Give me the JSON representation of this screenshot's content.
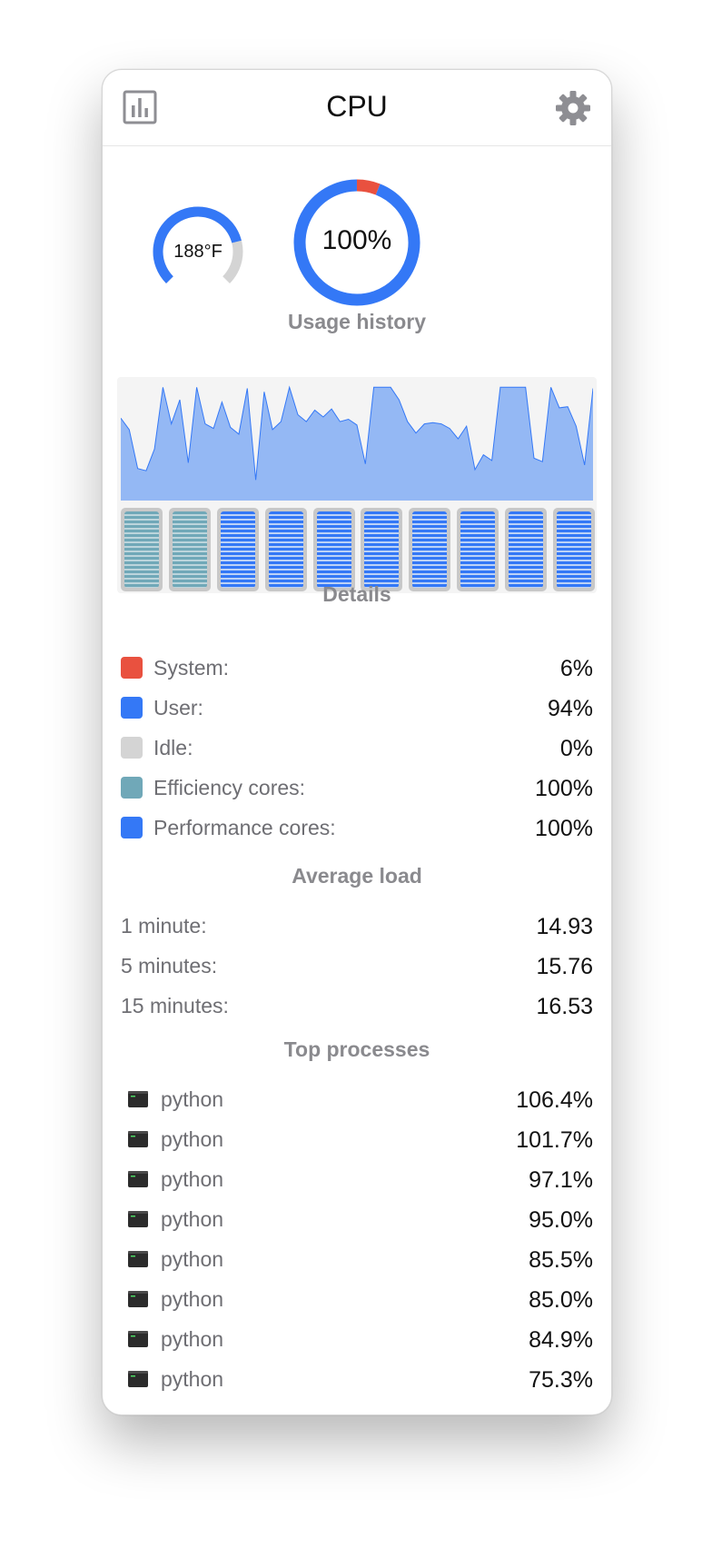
{
  "header": {
    "title": "CPU",
    "left_icon": "chart-icon",
    "right_icon": "gear-icon"
  },
  "gauges": {
    "temperature": {
      "text": "188°F",
      "fill_fraction": 0.78
    },
    "usage": {
      "text": "100%",
      "system_fraction": 0.06,
      "user_fraction": 0.94
    }
  },
  "sections": {
    "usage_history": "Usage history",
    "details": "Details",
    "average_load": "Average load",
    "top_processes": "Top processes"
  },
  "usage_history": {
    "values": [
      0.72,
      0.62,
      0.28,
      0.26,
      0.45,
      0.99,
      0.67,
      0.88,
      0.33,
      0.99,
      0.67,
      0.63,
      0.86,
      0.64,
      0.58,
      0.98,
      0.18,
      0.95,
      0.62,
      0.69,
      0.99,
      0.75,
      0.69,
      0.79,
      0.73,
      0.8,
      0.69,
      0.71,
      0.66,
      0.32,
      0.99,
      0.99,
      0.99,
      0.88,
      0.69,
      0.59,
      0.67,
      0.68,
      0.67,
      0.63,
      0.54,
      0.65,
      0.27,
      0.4,
      0.35,
      0.99,
      0.99,
      0.99,
      0.99,
      0.37,
      0.34,
      0.99,
      0.81,
      0.82,
      0.65,
      0.31,
      0.98
    ],
    "cores": [
      "efficiency",
      "efficiency",
      "performance",
      "performance",
      "performance",
      "performance",
      "performance",
      "performance",
      "performance",
      "performance"
    ],
    "area_color": "#94b8f4",
    "line_color": "#3478f6"
  },
  "colors": {
    "system": "#e9513f",
    "user": "#3478f6",
    "idle": "#d4d4d4",
    "efficiency": "#70a8b8",
    "performance": "#3478f6"
  },
  "details": [
    {
      "label": "System:",
      "value": "6%",
      "color": "#e9513f"
    },
    {
      "label": "User:",
      "value": "94%",
      "color": "#3478f6"
    },
    {
      "label": "Idle:",
      "value": "0%",
      "color": "#d4d4d4"
    },
    {
      "label": "Efficiency cores:",
      "value": "100%",
      "color": "#70a8b8"
    },
    {
      "label": "Performance cores:",
      "value": "100%",
      "color": "#3478f6"
    }
  ],
  "average_load": [
    {
      "label": "1 minute:",
      "value": "14.93"
    },
    {
      "label": "5 minutes:",
      "value": "15.76"
    },
    {
      "label": "15 minutes:",
      "value": "16.53"
    }
  ],
  "processes": [
    {
      "name": "python",
      "value": "106.4%",
      "icon": "terminal-icon"
    },
    {
      "name": "python",
      "value": "101.7%",
      "icon": "terminal-icon"
    },
    {
      "name": "python",
      "value": "97.1%",
      "icon": "terminal-icon"
    },
    {
      "name": "python",
      "value": "95.0%",
      "icon": "terminal-icon"
    },
    {
      "name": "python",
      "value": "85.5%",
      "icon": "terminal-icon"
    },
    {
      "name": "python",
      "value": "85.0%",
      "icon": "terminal-icon"
    },
    {
      "name": "python",
      "value": "84.9%",
      "icon": "terminal-icon"
    },
    {
      "name": "python",
      "value": "75.3%",
      "icon": "terminal-icon"
    }
  ]
}
